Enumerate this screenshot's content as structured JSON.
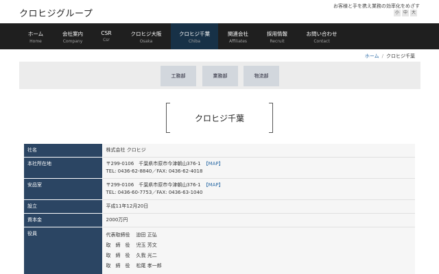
{
  "header": {
    "logo": "クロヒジグループ",
    "tagline": "お客様と手を携え業務の効率化をめざす",
    "font_sizes": [
      "小",
      "中",
      "大"
    ]
  },
  "nav": [
    {
      "jp": "ホーム",
      "en": "Home",
      "active": false
    },
    {
      "jp": "会社案内",
      "en": "Company",
      "active": false
    },
    {
      "jp": "CSR",
      "en": "Csr",
      "active": false
    },
    {
      "jp": "クロヒジ大阪",
      "en": "Osaka",
      "active": false
    },
    {
      "jp": "クロヒジ千葉",
      "en": "Chiba",
      "active": true
    },
    {
      "jp": "関連会社",
      "en": "Affiliates",
      "active": false
    },
    {
      "jp": "採用情報",
      "en": "Recruit",
      "active": false
    },
    {
      "jp": "お問い合わせ",
      "en": "Contact",
      "active": false
    }
  ],
  "breadcrumb": {
    "home": "ホーム",
    "separator": "/",
    "current": "クロヒジ千葉"
  },
  "departments": [
    "工務部",
    "業務部",
    "物流部"
  ],
  "page_title": "クロヒジ千葉",
  "company": {
    "name_label": "社名",
    "name_value": "株式会社 クロヒジ",
    "hq_label": "本社所在地",
    "hq_address": "〒299-0106　千葉県市原市今津朝山376-1",
    "hq_tel": "TEL: 0436-62-8840／FAX: 0436-62-4018",
    "annex_label": "安品室",
    "annex_address": "〒299-0106　千葉県市原市今津朝山376-1",
    "annex_tel": "TEL: 0436-60-7753／FAX: 0436-63-1040",
    "map_link": "【MAP】",
    "founded_label": "設立",
    "founded_value": "平成11年12月20日",
    "capital_label": "資本金",
    "capital_value": "2000万円",
    "officers_label": "役員",
    "officers": [
      {
        "role": "代表取締役",
        "name": "迫田 正弘"
      },
      {
        "role": "取　締　役",
        "name": "児玉 芳文"
      },
      {
        "role": "取　締　役",
        "name": "久我 光二"
      },
      {
        "role": "取　締　役",
        "name": "松尾 孝一郎"
      }
    ]
  }
}
